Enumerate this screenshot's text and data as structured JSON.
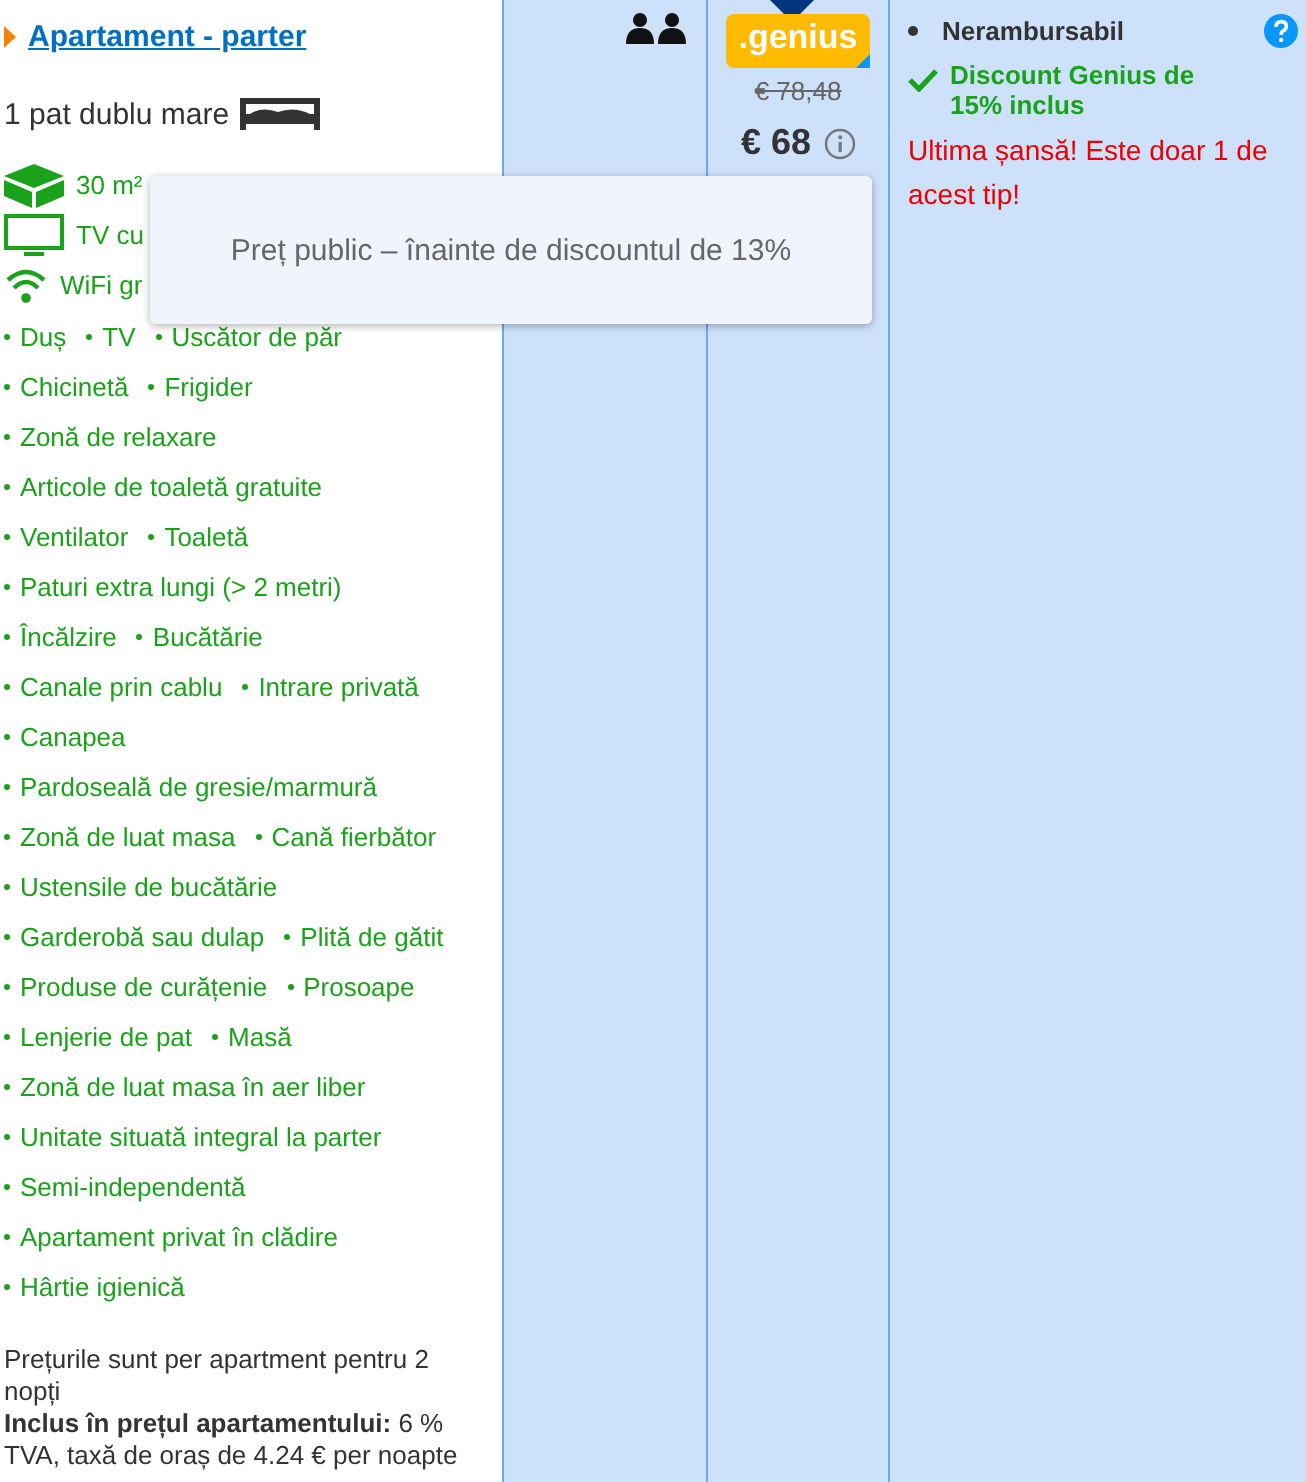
{
  "room": {
    "title": "Apartament - parter",
    "bed": "1 pat dublu mare",
    "featured": [
      {
        "kind": "area",
        "label": "30 m²"
      },
      {
        "kind": "tv",
        "label": "TV cu"
      },
      {
        "kind": "wifi",
        "label": "WiFi gr"
      }
    ],
    "amenity_rows": [
      [
        "Duș",
        "TV",
        "Uscător de păr"
      ],
      [
        "Chicinetă",
        "Frigider"
      ],
      [
        "Zonă de relaxare"
      ],
      [
        "Articole de toaletă gratuite"
      ],
      [
        "Ventilator",
        "Toaletă"
      ],
      [
        "Paturi extra lungi (> 2 metri)"
      ],
      [
        "Încălzire",
        "Bucătărie"
      ],
      [
        "Canale prin cablu",
        "Intrare privată"
      ],
      [
        "Canapea"
      ],
      [
        "Pardoseală de gresie/marmură"
      ],
      [
        "Zonă de luat masa",
        "Cană fierbător"
      ],
      [
        "Ustensile de bucătărie"
      ],
      [
        "Garderobă sau dulap",
        "Plită de gătit"
      ],
      [
        "Produse de curățenie",
        "Prosoape"
      ],
      [
        "Lenjerie de pat",
        "Masă"
      ],
      [
        "Zonă de luat masa în aer liber"
      ],
      [
        "Unitate situată integral la parter"
      ],
      [
        "Semi-independentă"
      ],
      [
        "Apartament privat în clădire"
      ],
      [
        "Hârtie igienică"
      ]
    ],
    "price_note": "Prețurile sunt per apartment pentru 2 nopți",
    "included": "**Inclus în prețul apartamentului:** 6 % TVA, taxă de oraș de 4.24 € per noapte"
  },
  "price": {
    "badge": ".genius",
    "old": "€ 78,48",
    "current": "€ 68"
  },
  "conditions": {
    "policy": "Nerambursabil",
    "discount": "Discount Genius de 15% inclus",
    "scarcity": "Ultima șansă! Este doar 1 de acest tip!"
  },
  "tooltip": {
    "text": "Preț public – înainte de discountul de 13%"
  }
}
